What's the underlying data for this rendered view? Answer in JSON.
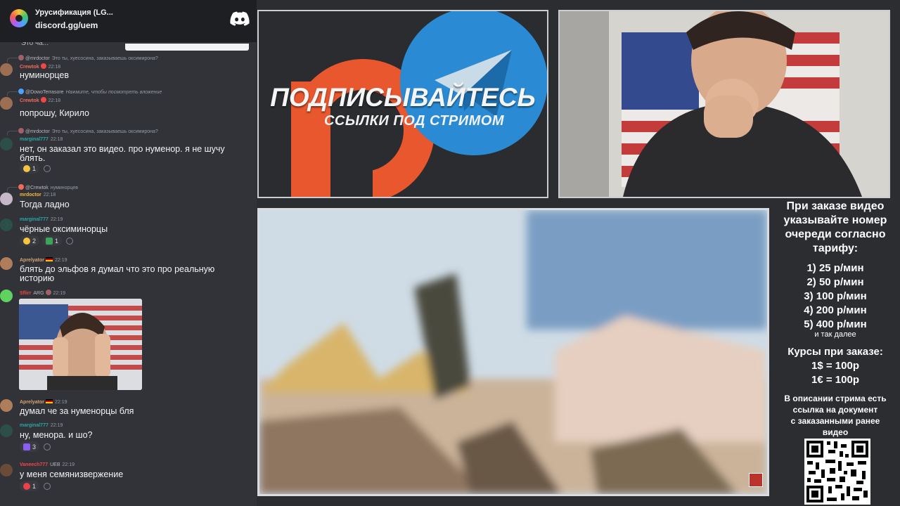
{
  "discord": {
    "server_name": "Урусификация (LG...",
    "invite": "discord.gg/uem",
    "logo_icon": "discord-icon",
    "cutoff_line": "Это ча..."
  },
  "messages": [
    {
      "reply_to_name": "@mrdoctor",
      "reply_text": "Это ты, хуесосина, заказываешь оксимирона?",
      "author": "Crewtok",
      "author_color": "#f26b5b",
      "time": "22:18",
      "text": "нуминорцев"
    },
    {
      "reply_to_name": "@DowoTerrasore",
      "reply_text": "Нажмите, чтобы посмотреть вложение",
      "author": "Crewtok",
      "author_color": "#f26b5b",
      "time": "22:18",
      "text": "попрошу, Кирило"
    },
    {
      "reply_to_name": "@mrdoctor",
      "reply_text": "Это ты, хуесосина, заказываешь оксимирона?",
      "author": "marginal777",
      "author_color": "#2ba4a4",
      "time": "22:18",
      "text_line1": "нет, он заказал это видео. про нуменор. я не шучу",
      "text_line2": "блять.",
      "reactions": [
        {
          "count": "1",
          "color": "#f5c542"
        }
      ]
    },
    {
      "reply_to_name": "@Crewtok",
      "reply_text": "нуминорцев",
      "author": "mrdoctor",
      "author_color": "#f7b942",
      "time": "22:18",
      "text": "Тогда ладно"
    },
    {
      "author": "marginal777",
      "author_color": "#2ba4a4",
      "time": "22:19",
      "text": "чёрные оксиминорцы",
      "reactions": [
        {
          "count": "2",
          "color": "#f5c542"
        },
        {
          "count": "1",
          "color": "#3ba55d"
        }
      ]
    },
    {
      "author": "Aprelyator",
      "author_color": "#d4a373",
      "time": "22:19",
      "text_line1": "блять до эльфов я думал что это про реальную",
      "text_line2": "историю"
    },
    {
      "author": "Sflirr",
      "author_color": "#f04747",
      "tag": "ARG",
      "time": "22:19"
    },
    {
      "author": "Aprelyator",
      "author_color": "#d4a373",
      "time": "22:19",
      "text": "думал че за нуменорцы бля"
    },
    {
      "author": "marginal777",
      "author_color": "#2ba4a4",
      "time": "22:19",
      "text": "ну, менора. и шо?",
      "reactions": [
        {
          "count": "3",
          "color": "#8b5cf6"
        }
      ]
    },
    {
      "author": "Vaneech777",
      "author_color": "#f04747",
      "tag": "UEB",
      "time": "22:19",
      "text": "у меня семянизвержение",
      "reactions": [
        {
          "count": "1",
          "color": "#ed4245"
        }
      ]
    }
  ],
  "banner": {
    "title": "ПОДПИСЫВАЙТЕСЬ",
    "subtitle": "ССЫЛКИ ПОД СТРИМОМ",
    "logos": [
      "patreon-icon",
      "telegram-icon"
    ],
    "patreon_color": "#e8572e",
    "telegram_color": "#2a8bd4"
  },
  "info": {
    "heading": [
      "При заказе видео",
      "указывайте номер",
      "очереди согласно",
      "тарифу:"
    ],
    "prices": [
      "1) 25 р/мин",
      "2) 50 р/мин",
      "3) 100 р/мин",
      "4) 200 р/мин",
      "5) 400 р/мин"
    ],
    "etc": "и так далее",
    "rates_title": "Курсы при заказе:",
    "rates": [
      "1$ = 100р",
      "1€ = 100р"
    ],
    "description": [
      "В описании стрима есть",
      "ссылка на документ",
      "с заказанными ранее",
      "видео"
    ],
    "qr_icon": "qr-code"
  }
}
